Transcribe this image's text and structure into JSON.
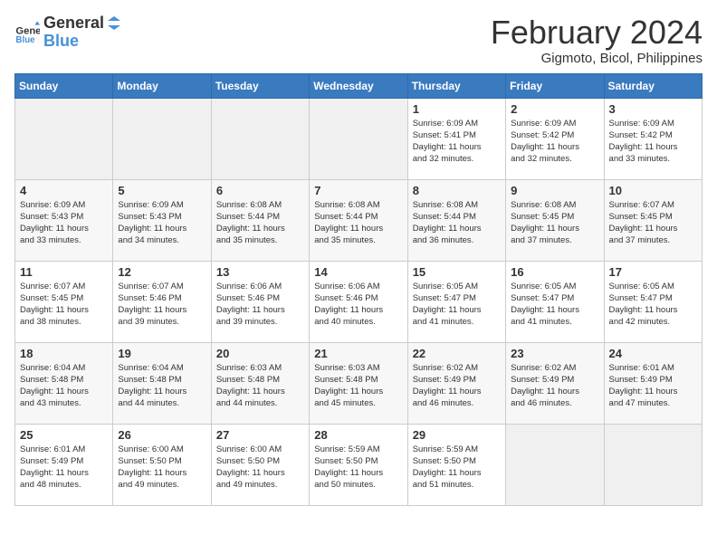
{
  "logo": {
    "text_general": "General",
    "text_blue": "Blue"
  },
  "title": "February 2024",
  "location": "Gigmoto, Bicol, Philippines",
  "days_header": [
    "Sunday",
    "Monday",
    "Tuesday",
    "Wednesday",
    "Thursday",
    "Friday",
    "Saturday"
  ],
  "weeks": [
    [
      {
        "day": "",
        "info": ""
      },
      {
        "day": "",
        "info": ""
      },
      {
        "day": "",
        "info": ""
      },
      {
        "day": "",
        "info": ""
      },
      {
        "day": "1",
        "info": "Sunrise: 6:09 AM\nSunset: 5:41 PM\nDaylight: 11 hours\nand 32 minutes."
      },
      {
        "day": "2",
        "info": "Sunrise: 6:09 AM\nSunset: 5:42 PM\nDaylight: 11 hours\nand 32 minutes."
      },
      {
        "day": "3",
        "info": "Sunrise: 6:09 AM\nSunset: 5:42 PM\nDaylight: 11 hours\nand 33 minutes."
      }
    ],
    [
      {
        "day": "4",
        "info": "Sunrise: 6:09 AM\nSunset: 5:43 PM\nDaylight: 11 hours\nand 33 minutes."
      },
      {
        "day": "5",
        "info": "Sunrise: 6:09 AM\nSunset: 5:43 PM\nDaylight: 11 hours\nand 34 minutes."
      },
      {
        "day": "6",
        "info": "Sunrise: 6:08 AM\nSunset: 5:44 PM\nDaylight: 11 hours\nand 35 minutes."
      },
      {
        "day": "7",
        "info": "Sunrise: 6:08 AM\nSunset: 5:44 PM\nDaylight: 11 hours\nand 35 minutes."
      },
      {
        "day": "8",
        "info": "Sunrise: 6:08 AM\nSunset: 5:44 PM\nDaylight: 11 hours\nand 36 minutes."
      },
      {
        "day": "9",
        "info": "Sunrise: 6:08 AM\nSunset: 5:45 PM\nDaylight: 11 hours\nand 37 minutes."
      },
      {
        "day": "10",
        "info": "Sunrise: 6:07 AM\nSunset: 5:45 PM\nDaylight: 11 hours\nand 37 minutes."
      }
    ],
    [
      {
        "day": "11",
        "info": "Sunrise: 6:07 AM\nSunset: 5:45 PM\nDaylight: 11 hours\nand 38 minutes."
      },
      {
        "day": "12",
        "info": "Sunrise: 6:07 AM\nSunset: 5:46 PM\nDaylight: 11 hours\nand 39 minutes."
      },
      {
        "day": "13",
        "info": "Sunrise: 6:06 AM\nSunset: 5:46 PM\nDaylight: 11 hours\nand 39 minutes."
      },
      {
        "day": "14",
        "info": "Sunrise: 6:06 AM\nSunset: 5:46 PM\nDaylight: 11 hours\nand 40 minutes."
      },
      {
        "day": "15",
        "info": "Sunrise: 6:05 AM\nSunset: 5:47 PM\nDaylight: 11 hours\nand 41 minutes."
      },
      {
        "day": "16",
        "info": "Sunrise: 6:05 AM\nSunset: 5:47 PM\nDaylight: 11 hours\nand 41 minutes."
      },
      {
        "day": "17",
        "info": "Sunrise: 6:05 AM\nSunset: 5:47 PM\nDaylight: 11 hours\nand 42 minutes."
      }
    ],
    [
      {
        "day": "18",
        "info": "Sunrise: 6:04 AM\nSunset: 5:48 PM\nDaylight: 11 hours\nand 43 minutes."
      },
      {
        "day": "19",
        "info": "Sunrise: 6:04 AM\nSunset: 5:48 PM\nDaylight: 11 hours\nand 44 minutes."
      },
      {
        "day": "20",
        "info": "Sunrise: 6:03 AM\nSunset: 5:48 PM\nDaylight: 11 hours\nand 44 minutes."
      },
      {
        "day": "21",
        "info": "Sunrise: 6:03 AM\nSunset: 5:48 PM\nDaylight: 11 hours\nand 45 minutes."
      },
      {
        "day": "22",
        "info": "Sunrise: 6:02 AM\nSunset: 5:49 PM\nDaylight: 11 hours\nand 46 minutes."
      },
      {
        "day": "23",
        "info": "Sunrise: 6:02 AM\nSunset: 5:49 PM\nDaylight: 11 hours\nand 46 minutes."
      },
      {
        "day": "24",
        "info": "Sunrise: 6:01 AM\nSunset: 5:49 PM\nDaylight: 11 hours\nand 47 minutes."
      }
    ],
    [
      {
        "day": "25",
        "info": "Sunrise: 6:01 AM\nSunset: 5:49 PM\nDaylight: 11 hours\nand 48 minutes."
      },
      {
        "day": "26",
        "info": "Sunrise: 6:00 AM\nSunset: 5:50 PM\nDaylight: 11 hours\nand 49 minutes."
      },
      {
        "day": "27",
        "info": "Sunrise: 6:00 AM\nSunset: 5:50 PM\nDaylight: 11 hours\nand 49 minutes."
      },
      {
        "day": "28",
        "info": "Sunrise: 5:59 AM\nSunset: 5:50 PM\nDaylight: 11 hours\nand 50 minutes."
      },
      {
        "day": "29",
        "info": "Sunrise: 5:59 AM\nSunset: 5:50 PM\nDaylight: 11 hours\nand 51 minutes."
      },
      {
        "day": "",
        "info": ""
      },
      {
        "day": "",
        "info": ""
      }
    ]
  ]
}
